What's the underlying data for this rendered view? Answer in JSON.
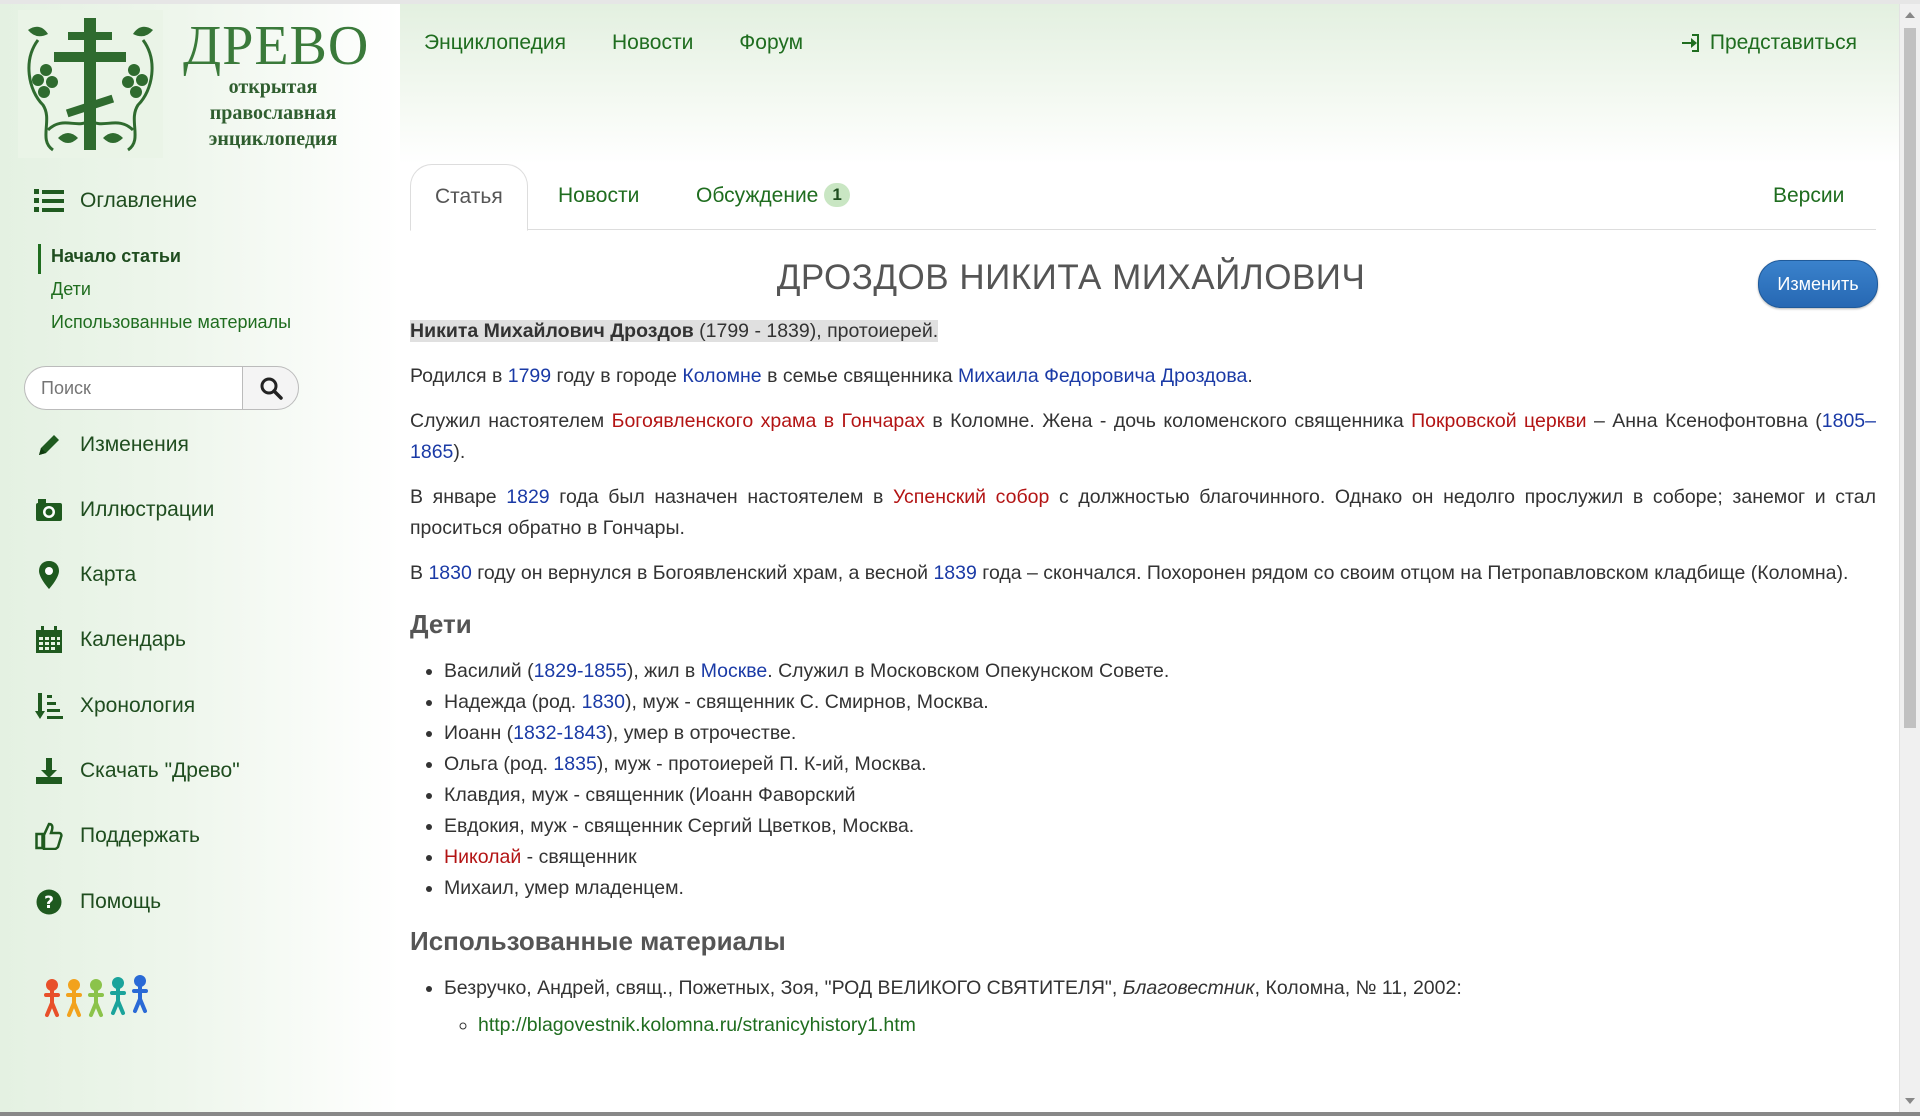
{
  "brand": {
    "name": "ДРЕВО",
    "subtitle": [
      "открытая",
      "православная",
      "энциклопедия"
    ]
  },
  "topnav": {
    "items": [
      "Энциклопедия",
      "Новости",
      "Форум"
    ],
    "login": "Представиться"
  },
  "sidebar": {
    "toc_label": "Оглавление",
    "toc_items": [
      "Начало статьи",
      "Дети",
      "Использованные материалы"
    ],
    "search_placeholder": "Поиск",
    "nav": [
      {
        "label": "Изменения",
        "icon": "pencil-icon"
      },
      {
        "label": "Иллюстрации",
        "icon": "camera-icon"
      },
      {
        "label": "Карта",
        "icon": "map-marker-icon"
      },
      {
        "label": "Календарь",
        "icon": "calendar-icon"
      },
      {
        "label": "Хронология",
        "icon": "chronology-sort-icon"
      },
      {
        "label": "Скачать \"Древо\"",
        "icon": "download-icon"
      },
      {
        "label": "Поддержать",
        "icon": "thumbs-up-icon"
      },
      {
        "label": "Помощь",
        "icon": "help-icon"
      }
    ]
  },
  "tabs": {
    "article": "Статья",
    "news": "Новости",
    "discussion": "Обсуждение",
    "discussion_count": "1",
    "versions": "Версии"
  },
  "article": {
    "title": "ДРОЗДОВ НИКИТА МИХАЙЛОВИЧ",
    "edit": "Изменить",
    "intro_name": "Никита Михайлович Дроздов",
    "intro_rest": " (1799 - 1839), протоиерей.",
    "p1": {
      "t1": "Родился в ",
      "l1": "1799",
      "t2": " году в городе ",
      "l2": "Коломне",
      "t3": " в семье священника ",
      "l3": "Михаила Федоровича Дроздова",
      "t4": "."
    },
    "p2": {
      "t1": "Служил настоятелем ",
      "l1": "Богоявленского храма в Гончарах",
      "t2": " в Коломне. Жена - дочь коломенского священника ",
      "l2": "Покровской церкви",
      "t3": " – Анна Ксенофонтовна (",
      "l3": "1805–1865",
      "t4": ")."
    },
    "p3": {
      "t1": "В январе ",
      "l1": "1829",
      "t2": " года был назначен настоятелем в ",
      "l2": "Успенский собор",
      "t3": " с должностью благочинного. Однако он недолго прослужил в соборе; занемог и стал проситься обратно в Гончары."
    },
    "p4": {
      "t1": "В ",
      "l1": "1830",
      "t2": " году он вернулся в Богоявленский храм, а весной ",
      "l2": "1839",
      "t3": " года – скончался. Похоронен рядом со своим отцом на Петропавловском кладбище (Коломна)."
    },
    "children_heading": "Дети",
    "children": {
      "c1a": "Василий (",
      "c1l": "1829-1855",
      "c1b": "), жил в ",
      "c1l2": "Москве",
      "c1c": ". Служил в Московском Опекунском Совете.",
      "c2a": "Надежда (род. ",
      "c2l": "1830",
      "c2b": "), муж - священник С. Смирнов, Москва.",
      "c3a": "Иоанн (",
      "c3l": "1832-1843",
      "c3b": "), умер в отрочестве.",
      "c4a": "Ольга (род. ",
      "c4l": "1835",
      "c4b": "), муж - протоиерей П. К-ий, Москва.",
      "c5": "Клавдия, муж - священник (Иоанн Фаворский",
      "c6": "Евдокия, муж - священник Сергий Цветков, Москва.",
      "c7l": "Николай",
      "c7b": " - священник",
      "c8": "Михаил, умер младенцем."
    },
    "sources_heading": "Использованные материалы",
    "source1_a": "Безручко, Андрей, свящ., Пожетных, Зоя, \"РОД ВЕЛИКОГО СВЯТИТЕЛЯ\", ",
    "source1_italic": "Благовестник",
    "source1_b": ", Коломна, № 11, 2002:",
    "source1_url": "http://blagovestnik.kolomna.ru/stranicyhistory1.htm"
  },
  "colors": {
    "brand_green": "#1f6d1f",
    "link_blue": "#1a3aa6",
    "link_red": "#b31414",
    "button_blue": "#2768b3"
  }
}
